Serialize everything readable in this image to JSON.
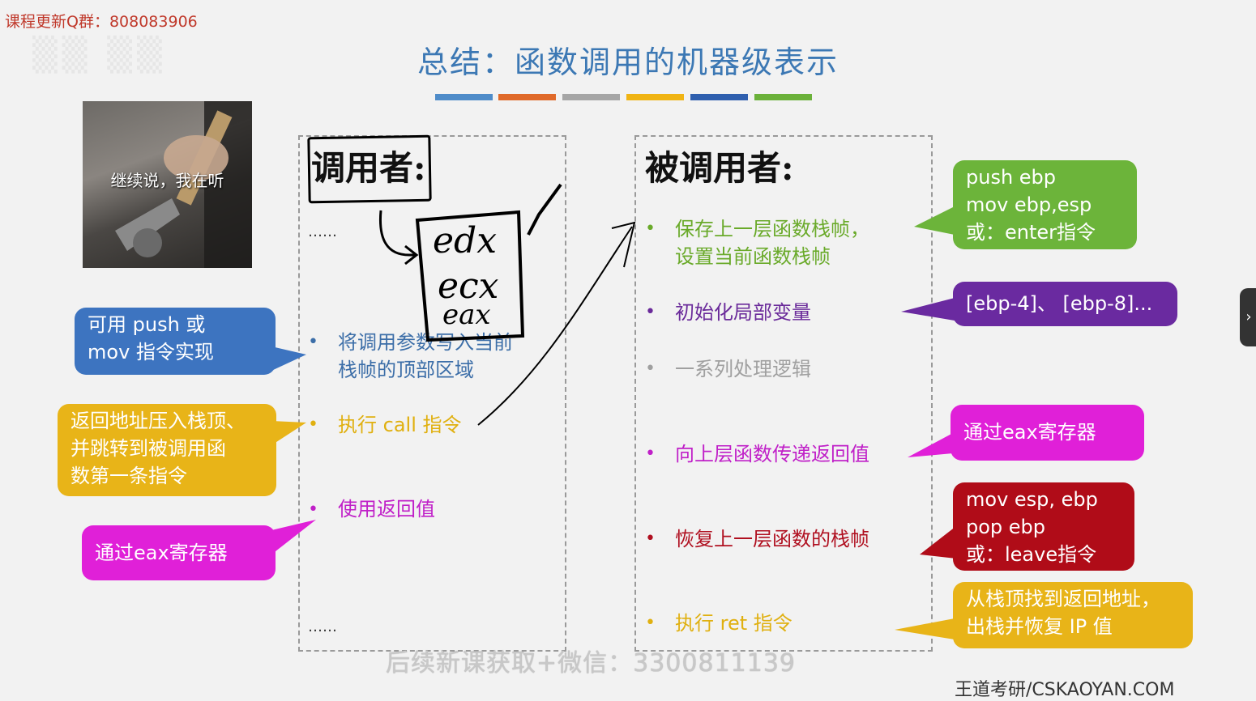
{
  "watermark_top": "课程更新Q群：808083906",
  "title": "总结：函数调用的机器级表示",
  "strip_colors": [
    "#4f8cc9",
    "#e06a2a",
    "#a6a6a6",
    "#f0b414",
    "#2f5fae",
    "#6bb13a"
  ],
  "meme_caption": "继续说，我在听",
  "caller": {
    "heading": "调用者:",
    "ellipsis_top": "……",
    "items": [
      {
        "text_line1": "将调用参数写入当前",
        "text_line2": "栈帧的顶部区域",
        "color": "#3c6ea8"
      },
      {
        "text_line1": "执行 call 指令",
        "text_line2": "",
        "color": "#e0b010"
      },
      {
        "text_line1": "使用返回值",
        "text_line2": "",
        "color": "#c020c8"
      }
    ],
    "ellipsis_bottom": "……",
    "handwriting": [
      "edx",
      "ecx",
      "eax"
    ]
  },
  "callee": {
    "heading": "被调用者:",
    "items": [
      {
        "text_line1": "保存上一层函数栈帧，",
        "text_line2": "设置当前函数栈帧",
        "color": "#6aaa2a"
      },
      {
        "text_line1": "初始化局部变量",
        "text_line2": "",
        "color": "#6a2a9a"
      },
      {
        "text_line1": "一系列处理逻辑",
        "text_line2": "",
        "color": "#a0a0a0"
      },
      {
        "text_line1": "向上层函数传递返回值",
        "text_line2": "",
        "color": "#c020c8"
      },
      {
        "text_line1": "恢复上一层函数的栈帧",
        "text_line2": "",
        "color": "#b01020"
      },
      {
        "text_line1": "执行 ret 指令",
        "text_line2": "",
        "color": "#e0b010"
      }
    ]
  },
  "callouts_left": [
    {
      "lines": [
        "可用 push 或",
        "mov 指令实现"
      ],
      "color": "#3d74c0"
    },
    {
      "lines": [
        "返回地址压入栈顶、",
        "并跳转到被调用函",
        "数第一条指令"
      ],
      "color": "#e8b418"
    },
    {
      "lines": [
        "通过eax寄存器"
      ],
      "color": "#e020d8"
    }
  ],
  "callouts_right": [
    {
      "lines": [
        "push ebp",
        "mov ebp,esp",
        "或：enter指令"
      ],
      "color": "#6cb43a"
    },
    {
      "lines": [
        "[ebp-4]、 [ebp-8]..."
      ],
      "color": "#6a2aa0"
    },
    {
      "lines": [
        "通过eax寄存器"
      ],
      "color": "#e020d8"
    },
    {
      "lines": [
        "mov esp, ebp",
        "pop ebp",
        "或：leave指令"
      ],
      "color": "#b00c18"
    },
    {
      "lines": [
        "从栈顶找到返回地址，",
        "出栈并恢复 IP 值"
      ],
      "color": "#e8b418"
    }
  ],
  "watermark_bottom": "后续新课获取+微信：3300811139",
  "brand": "王道考研/CSKAOYAN.COM",
  "side_tab_glyph": "›"
}
